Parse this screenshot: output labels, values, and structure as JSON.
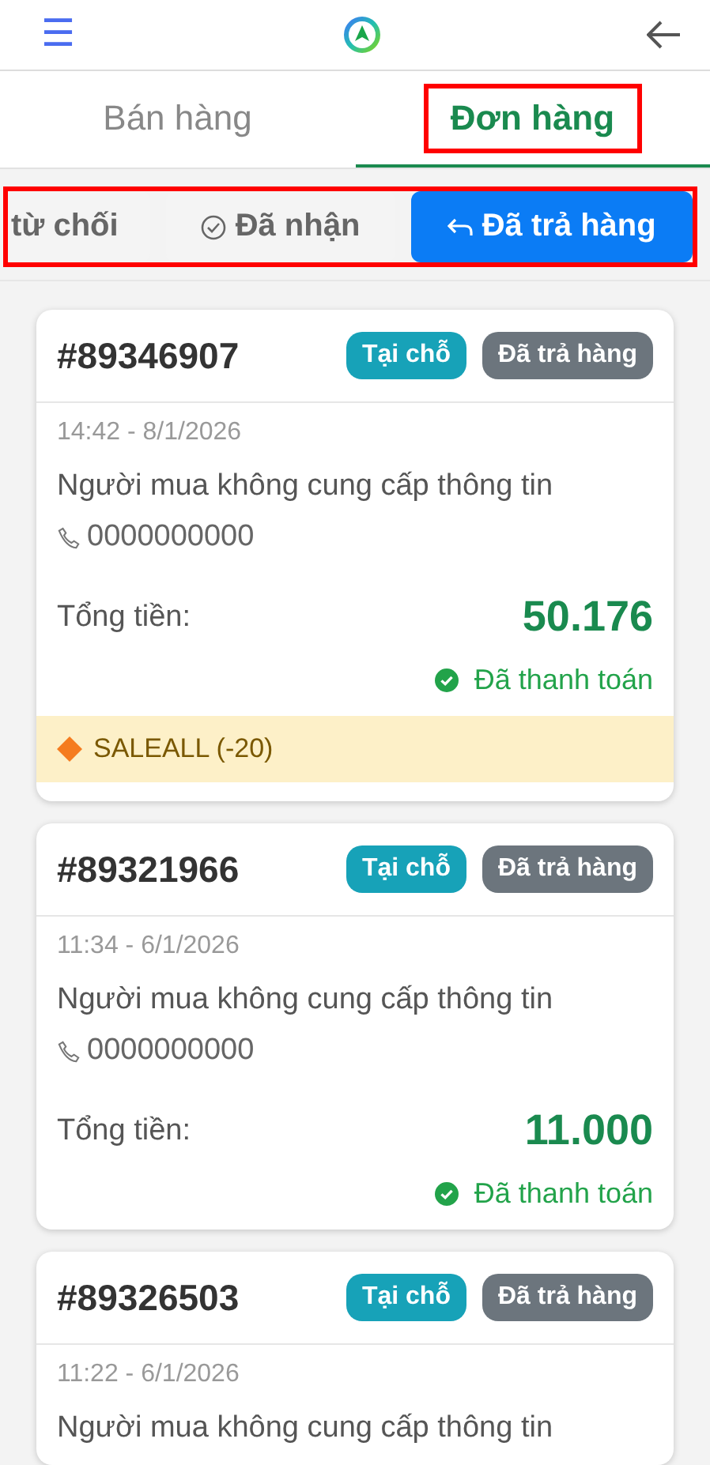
{
  "header": {
    "menu": "☰"
  },
  "tabs": [
    {
      "label": "Bán hàng",
      "selected": false,
      "highlighted": false
    },
    {
      "label": "Đơn hàng",
      "selected": true,
      "highlighted": true
    }
  ],
  "filters": {
    "highlighted": true,
    "items": [
      {
        "label": "từ chối",
        "kind": "plain",
        "selected": false
      },
      {
        "label": "Đã nhận",
        "kind": "received",
        "selected": false
      },
      {
        "label": "Đã trả hàng",
        "kind": "returned",
        "selected": true
      }
    ]
  },
  "orders": [
    {
      "number": "#89346907",
      "type": "Tại chỗ",
      "status": "Đã trả hàng",
      "time": "14:42 - 8/1/2026",
      "buyer": "Người mua không cung cấp thông tin",
      "phone": "0000000000",
      "total_label": "Tổng tiền:",
      "total": "50.176",
      "payment": "Đã thanh toán",
      "coupon": "SALEALL (-20)"
    },
    {
      "number": "#89321966",
      "type": "Tại chỗ",
      "status": "Đã trả hàng",
      "time": "11:34 - 6/1/2026",
      "buyer": "Người mua không cung cấp thông tin",
      "phone": "0000000000",
      "total_label": "Tổng tiền:",
      "total": "11.000",
      "payment": "Đã thanh toán"
    },
    {
      "number": "#89326503",
      "type": "Tại chỗ",
      "status": "Đã trả hàng",
      "time": "11:22 - 6/1/2026",
      "buyer": "Người mua không cung cấp thông tin"
    }
  ]
}
